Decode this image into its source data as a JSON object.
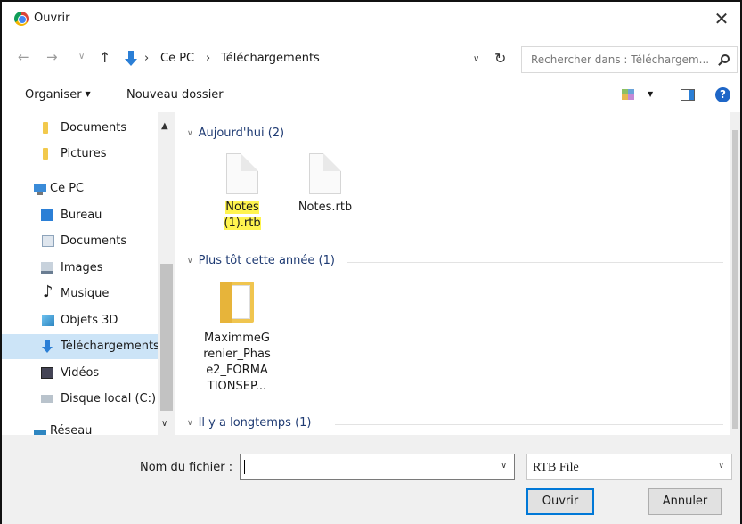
{
  "window": {
    "title": "Ouvrir"
  },
  "address": {
    "path": [
      "Ce PC",
      "Téléchargements"
    ],
    "search_placeholder": "Rechercher dans : Téléchargem..."
  },
  "toolbar": {
    "organiser": "Organiser",
    "new_folder": "Nouveau dossier"
  },
  "sidebar": {
    "items": [
      {
        "label": "Documents",
        "icon": "folder-icon"
      },
      {
        "label": "Pictures",
        "icon": "folder-icon"
      },
      {
        "label": "Ce PC",
        "icon": "computer-icon"
      },
      {
        "label": "Bureau",
        "icon": "desktop-icon"
      },
      {
        "label": "Documents",
        "icon": "documents-icon"
      },
      {
        "label": "Images",
        "icon": "images-icon"
      },
      {
        "label": "Musique",
        "icon": "music-icon"
      },
      {
        "label": "Objets 3D",
        "icon": "3d-objects-icon"
      },
      {
        "label": "Téléchargements",
        "icon": "download-icon",
        "selected": true
      },
      {
        "label": "Vidéos",
        "icon": "video-icon"
      },
      {
        "label": "Disque local (C:)",
        "icon": "disk-icon"
      },
      {
        "label": "Réseau",
        "icon": "network-icon"
      }
    ]
  },
  "content": {
    "groups": [
      {
        "header": "Aujourd'hui (2)",
        "files": [
          {
            "name_line1": "Notes",
            "name_line2": "(1).rtb",
            "highlighted": true
          },
          {
            "name_line1": "Notes.rtb",
            "name_line2": ""
          }
        ]
      },
      {
        "header": "Plus tôt cette année (1)",
        "files": [
          {
            "name_lines": [
              "MaximmeG",
              "renier_Phas",
              "e2_FORMA",
              "TIONSEP..."
            ]
          }
        ]
      },
      {
        "header": "Il y a longtemps (1)"
      }
    ]
  },
  "footer": {
    "filename_label": "Nom du fichier :",
    "filename_value": "",
    "filetype": "RTB File",
    "open_button": "Ouvrir",
    "cancel_button": "Annuler"
  },
  "colors": {
    "selection": "#cce4f7",
    "highlight": "#fff44f",
    "accent": "#0078d7"
  }
}
